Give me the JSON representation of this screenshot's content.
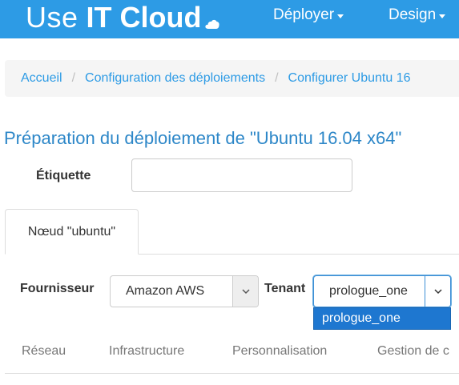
{
  "navbar": {
    "brand_light": "Use",
    "brand_bold": "IT Cloud",
    "menu": [
      {
        "label": "Déployer"
      },
      {
        "label": "Design"
      }
    ]
  },
  "breadcrumb": [
    {
      "label": "Accueil"
    },
    {
      "label": "Configuration des déploiements"
    },
    {
      "label": "Configurer Ubuntu 16"
    }
  ],
  "page": {
    "title": "Préparation du déploiement de \"Ubuntu 16.04 x64\""
  },
  "form": {
    "label_field": {
      "label": "Étiquette",
      "value": ""
    }
  },
  "tabs": [
    {
      "label": "Nœud \"ubuntu\"",
      "active": true
    }
  ],
  "node": {
    "provider": {
      "label": "Fournisseur",
      "value": "Amazon AWS"
    },
    "tenant": {
      "label": "Tenant",
      "value": "prologue_one",
      "options": [
        "prologue_one"
      ]
    }
  },
  "subtabs": [
    {
      "label": "Réseau"
    },
    {
      "label": "Infrastructure"
    },
    {
      "label": "Personnalisation"
    },
    {
      "label": "Gestion de c"
    }
  ],
  "colors": {
    "navbar": "#2d9be5",
    "link": "#2d9be5",
    "title": "#2d87c8",
    "dropdown_highlight": "#1e77d0"
  }
}
